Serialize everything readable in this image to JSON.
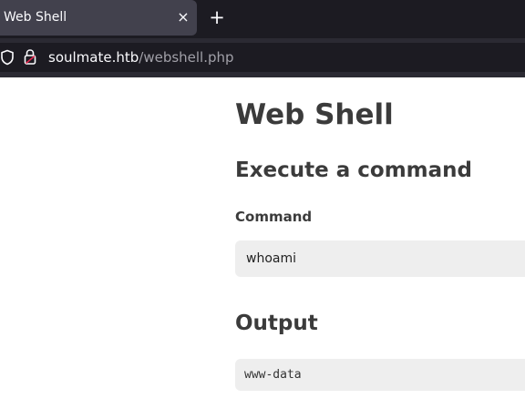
{
  "browser": {
    "tab": {
      "title": "Web Shell",
      "close_glyph": "×"
    },
    "new_tab_glyph": "+",
    "url": {
      "host": "soulmate.htb",
      "path": "/webshell.php"
    },
    "icons": [
      "shield-icon",
      "lock-icon",
      "close-icon",
      "plus-icon"
    ]
  },
  "page": {
    "title": "Web Shell",
    "execute_heading": "Execute a command",
    "command_label": "Command",
    "command_value": "whoami",
    "output_heading": "Output",
    "output_text": "www-data"
  },
  "colors": {
    "tabbar_bg": "#1c1b22",
    "active_tab_bg": "#42414d",
    "navbar_bg": "#2b2a33",
    "text_heading": "#3b3b3b",
    "field_bg": "#eeeeee"
  }
}
